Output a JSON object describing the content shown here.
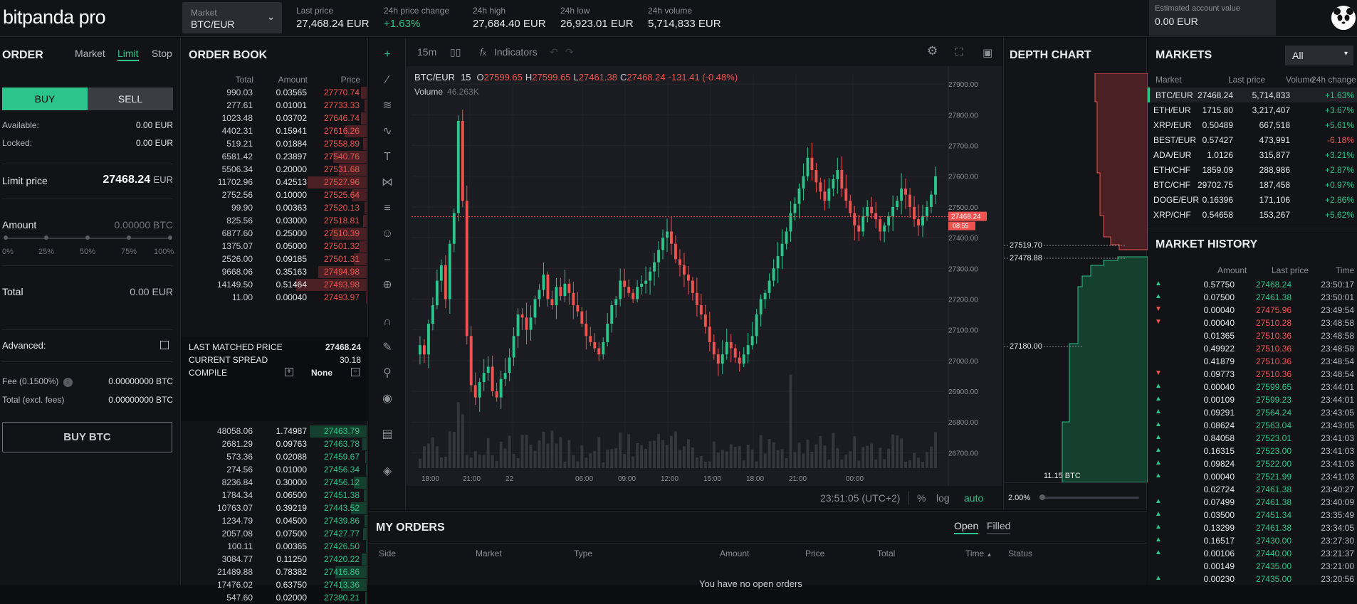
{
  "topbar": {
    "logo": "bitpanda",
    "logo_suffix": "pro",
    "market_label": "Market",
    "market_value": "BTC/EUR",
    "stats": [
      {
        "label": "Last price",
        "value": "27,468.24 EUR",
        "color": "default"
      },
      {
        "label": "24h price change",
        "value": "+1.63%",
        "color": "green"
      },
      {
        "label": "24h high",
        "value": "27,684.40 EUR",
        "color": "default"
      },
      {
        "label": "24h low",
        "value": "26,923.01 EUR",
        "color": "default"
      },
      {
        "label": "24h volume",
        "value": "5,714,833 EUR",
        "color": "default"
      }
    ],
    "account_label": "Estimated account value",
    "account_value": "0.00 EUR"
  },
  "order": {
    "title": "ORDER",
    "tabs": [
      "Market",
      "Limit",
      "Stop"
    ],
    "active_tab": "Limit",
    "buy": "BUY",
    "sell": "SELL",
    "available_label": "Available:",
    "available_value": "0.00 EUR",
    "locked_label": "Locked:",
    "locked_value": "0.00 EUR",
    "limit_label": "Limit price",
    "limit_value": "27468.24",
    "limit_unit": "EUR",
    "amount_label": "Amount",
    "amount_value": "0.00000",
    "amount_unit": "BTC",
    "slider_ticks": [
      "0%",
      "25%",
      "50%",
      "75%",
      "100%"
    ],
    "total_label": "Total",
    "total_value": "0.00",
    "total_unit": "EUR",
    "advanced_label": "Advanced:",
    "fee_label": "Fee (0.1500%)",
    "fee_value": "0.00000000 BTC",
    "total_excl_label": "Total (excl. fees)",
    "total_excl_value": "0.00000000 BTC",
    "buy_button": "BUY BTC"
  },
  "orderbook": {
    "title": "ORDER BOOK",
    "headers": [
      "Total",
      "Amount",
      "Price"
    ],
    "asks": [
      {
        "total": "990.03",
        "amount": "0.03565",
        "price": "27770.74",
        "depth": 0.03
      },
      {
        "total": "277.61",
        "amount": "0.01001",
        "price": "27733.33",
        "depth": 0.01
      },
      {
        "total": "1023.48",
        "amount": "0.03702",
        "price": "27646.74",
        "depth": 0.03
      },
      {
        "total": "4402.31",
        "amount": "0.15941",
        "price": "27616.26",
        "depth": 0.12
      },
      {
        "total": "519.21",
        "amount": "0.01884",
        "price": "27558.89",
        "depth": 0.02
      },
      {
        "total": "6581.42",
        "amount": "0.23897",
        "price": "27540.76",
        "depth": 0.18
      },
      {
        "total": "5506.34",
        "amount": "0.20000",
        "price": "27531.68",
        "depth": 0.15
      },
      {
        "total": "11702.96",
        "amount": "0.42513",
        "price": "27527.96",
        "depth": 0.32
      },
      {
        "total": "2752.56",
        "amount": "0.10000",
        "price": "27525.64",
        "depth": 0.08
      },
      {
        "total": "99.90",
        "amount": "0.00363",
        "price": "27520.13",
        "depth": 0.01
      },
      {
        "total": "825.56",
        "amount": "0.03000",
        "price": "27518.81",
        "depth": 0.02
      },
      {
        "total": "6877.60",
        "amount": "0.25000",
        "price": "27510.39",
        "depth": 0.19
      },
      {
        "total": "1375.07",
        "amount": "0.05000",
        "price": "27501.32",
        "depth": 0.04
      },
      {
        "total": "2526.00",
        "amount": "0.09185",
        "price": "27501.31",
        "depth": 0.07
      },
      {
        "total": "9668.06",
        "amount": "0.35163",
        "price": "27494.98",
        "depth": 0.26
      },
      {
        "total": "14149.50",
        "amount": "0.51464",
        "price": "27493.98",
        "depth": 0.38
      },
      {
        "total": "11.00",
        "amount": "0.00040",
        "price": "27493.97",
        "depth": 0.005
      }
    ],
    "last_matched_label": "LAST MATCHED PRICE",
    "last_matched_value": "27468.24",
    "spread_label": "CURRENT SPREAD",
    "spread_value": "30.18",
    "compile_label": "COMPILE",
    "compile_value": "None",
    "bids": [
      {
        "total": "48058.06",
        "amount": "1.74987",
        "price": "27463.79",
        "depth": 1.0
      },
      {
        "total": "2681.29",
        "amount": "0.09763",
        "price": "27463.78",
        "depth": 0.07
      },
      {
        "total": "573.36",
        "amount": "0.02088",
        "price": "27459.67",
        "depth": 0.02
      },
      {
        "total": "274.56",
        "amount": "0.01000",
        "price": "27456.34",
        "depth": 0.01
      },
      {
        "total": "8236.84",
        "amount": "0.30000",
        "price": "27456.12",
        "depth": 0.22
      },
      {
        "total": "1784.34",
        "amount": "0.06500",
        "price": "27451.38",
        "depth": 0.05
      },
      {
        "total": "10763.07",
        "amount": "0.39219",
        "price": "27443.52",
        "depth": 0.28
      },
      {
        "total": "1234.79",
        "amount": "0.04500",
        "price": "27439.86",
        "depth": 0.04
      },
      {
        "total": "2057.08",
        "amount": "0.07500",
        "price": "27427.77",
        "depth": 0.06
      },
      {
        "total": "100.11",
        "amount": "0.00365",
        "price": "27426.50",
        "depth": 0.01
      },
      {
        "total": "3084.77",
        "amount": "0.11250",
        "price": "27420.22",
        "depth": 0.09
      },
      {
        "total": "21489.88",
        "amount": "0.78382",
        "price": "27416.86",
        "depth": 0.55
      },
      {
        "total": "17476.02",
        "amount": "0.63750",
        "price": "27413.36",
        "depth": 0.45
      },
      {
        "total": "547.60",
        "amount": "0.02000",
        "price": "27380.21",
        "depth": 0.02
      }
    ]
  },
  "chart": {
    "interval": "15m",
    "indicators_label": "Indicators",
    "symbol": "BTC/EUR",
    "symbol_interval": "15",
    "ohlc": {
      "o": "27599.65",
      "h": "27599.65",
      "l": "27461.38",
      "c": "27468.24",
      "change": "-131.41 (-0.48%)"
    },
    "volume_label": "Volume",
    "volume_value": "46.263K",
    "last_price_tag": "27468.24",
    "countdown_tag": "08:55",
    "time_display": "23:51:05 (UTC+2)",
    "bottom_opts": [
      "%",
      "log",
      "auto"
    ],
    "up_color": "#2bc48a",
    "down_color": "#ef5350"
  },
  "chart_data": {
    "type": "candlestick",
    "x_ticks": [
      "18:00",
      "21:00",
      "22",
      "06:00",
      "09:00",
      "12:00",
      "15:00",
      "18:00",
      "21:00",
      "00:00"
    ],
    "y_ticks": [
      "27900.00",
      "27800.00",
      "27700.00",
      "27600.00",
      "27500.00",
      "27400.00",
      "27300.00",
      "27200.00",
      "27100.00",
      "27000.00",
      "26900.00",
      "26800.00",
      "26700.00"
    ],
    "ylim": [
      26650,
      27935
    ],
    "series": [
      {
        "name": "Volume",
        "values": []
      }
    ],
    "closes": [
      27050,
      27020,
      27120,
      27180,
      27260,
      27310,
      27200,
      27380,
      27480,
      27780,
      27520,
      27080,
      26920,
      26880,
      26930,
      26960,
      26980,
      26900,
      26880,
      26940,
      26960,
      27010,
      27080,
      27150,
      27140,
      27100,
      27140,
      27200,
      27230,
      27280,
      27200,
      27180,
      27240,
      27210,
      27250,
      27220,
      27180,
      27160,
      27120,
      27080,
      27060,
      27040,
      27020,
      27060,
      27120,
      27180,
      27200,
      27260,
      27240,
      27220,
      27200,
      27240,
      27250,
      27260,
      27290,
      27320,
      27360,
      27400,
      27420,
      27380,
      27330,
      27310,
      27280,
      27260,
      27220,
      27180,
      27150,
      27110,
      27060,
      27020,
      26990,
      27020,
      27060,
      27040,
      27010,
      26990,
      27020,
      27050,
      27080,
      27150,
      27200,
      27220,
      27260,
      27300,
      27340,
      27380,
      27420,
      27480,
      27510,
      27560,
      27600,
      27660,
      27620,
      27580,
      27550,
      27520,
      27560,
      27590,
      27620,
      27560,
      27520,
      27480,
      27440,
      27420,
      27470,
      27500,
      27480,
      27460,
      27420,
      27440,
      27470,
      27500,
      27520,
      27560,
      27540,
      27500,
      27460,
      27440,
      27470,
      27500,
      27540,
      27600
    ]
  },
  "depth": {
    "title": "DEPTH CHART",
    "ask_label": "27519.70",
    "mid_label": "27478.88",
    "bid_label": "27180.00",
    "volume_label": "11.15 BTC",
    "zoom_label": "2.00%"
  },
  "my_orders": {
    "title": "MY ORDERS",
    "tabs": [
      "Open",
      "Filled"
    ],
    "active_tab": "Open",
    "columns": [
      "Side",
      "Market",
      "Type",
      "Amount",
      "Price",
      "Total",
      "Time",
      "Status"
    ],
    "empty": "You have no open orders"
  },
  "markets": {
    "title": "MARKETS",
    "filter_value": "All",
    "headers": [
      "Market",
      "Last price",
      "Volume",
      "24h change"
    ],
    "rows": [
      {
        "market": "BTC/EUR",
        "price": "27468.24",
        "volume": "5,714,833",
        "change": "+1.63%",
        "dir": "up"
      },
      {
        "market": "ETH/EUR",
        "price": "1715.80",
        "volume": "3,217,407",
        "change": "+3.67%",
        "dir": "up"
      },
      {
        "market": "XRP/EUR",
        "price": "0.50489",
        "volume": "667,518",
        "change": "+5.61%",
        "dir": "up"
      },
      {
        "market": "BEST/EUR",
        "price": "0.57427",
        "volume": "473,991",
        "change": "-6.18%",
        "dir": "down"
      },
      {
        "market": "ADA/EUR",
        "price": "1.0126",
        "volume": "315,877",
        "change": "+3.21%",
        "dir": "up"
      },
      {
        "market": "ETH/CHF",
        "price": "1859.09",
        "volume": "288,986",
        "change": "+2.87%",
        "dir": "up"
      },
      {
        "market": "BTC/CHF",
        "price": "29702.75",
        "volume": "187,458",
        "change": "+0.97%",
        "dir": "up"
      },
      {
        "market": "DOGE/EUR",
        "price": "0.16396",
        "volume": "171,106",
        "change": "+2.86%",
        "dir": "up"
      },
      {
        "market": "XRP/CHF",
        "price": "0.54658",
        "volume": "153,267",
        "change": "+5.62%",
        "dir": "up"
      }
    ]
  },
  "history": {
    "title": "MARKET HISTORY",
    "headers": [
      "Amount",
      "Last price",
      "Time"
    ],
    "rows": [
      {
        "dir": "up",
        "amount": "0.57750",
        "price": "27468.24",
        "time": "23:50:17"
      },
      {
        "dir": "up",
        "amount": "0.07500",
        "price": "27461.38",
        "time": "23:50:01"
      },
      {
        "dir": "down",
        "amount": "0.00040",
        "price": "27475.96",
        "time": "23:49:54"
      },
      {
        "dir": "down",
        "amount": "0.00040",
        "price": "27510.28",
        "time": "23:48:58"
      },
      {
        "dir": "none-red",
        "amount": "0.01365",
        "price": "27510.36",
        "time": "23:48:58"
      },
      {
        "dir": "none-red",
        "amount": "0.49922",
        "price": "27510.36",
        "time": "23:48:58"
      },
      {
        "dir": "none-red",
        "amount": "0.41879",
        "price": "27510.36",
        "time": "23:48:54"
      },
      {
        "dir": "down",
        "amount": "0.09773",
        "price": "27510.36",
        "time": "23:48:54"
      },
      {
        "dir": "up",
        "amount": "0.00040",
        "price": "27599.65",
        "time": "23:44:01"
      },
      {
        "dir": "up",
        "amount": "0.00109",
        "price": "27599.23",
        "time": "23:44:01"
      },
      {
        "dir": "up",
        "amount": "0.09291",
        "price": "27564.24",
        "time": "23:43:05"
      },
      {
        "dir": "up",
        "amount": "0.08624",
        "price": "27563.04",
        "time": "23:43:05"
      },
      {
        "dir": "up",
        "amount": "0.84058",
        "price": "27523.01",
        "time": "23:41:03"
      },
      {
        "dir": "up",
        "amount": "0.16315",
        "price": "27523.00",
        "time": "23:41:03"
      },
      {
        "dir": "up",
        "amount": "0.09824",
        "price": "27522.00",
        "time": "23:41:03"
      },
      {
        "dir": "up",
        "amount": "0.00040",
        "price": "27521.99",
        "time": "23:41:03"
      },
      {
        "dir": "none-green",
        "amount": "0.02724",
        "price": "27461.38",
        "time": "23:40:27"
      },
      {
        "dir": "up",
        "amount": "0.07499",
        "price": "27461.38",
        "time": "23:40:09"
      },
      {
        "dir": "up",
        "amount": "0.03500",
        "price": "27451.34",
        "time": "23:35:49"
      },
      {
        "dir": "up",
        "amount": "0.13299",
        "price": "27461.38",
        "time": "23:34:05"
      },
      {
        "dir": "up",
        "amount": "0.16517",
        "price": "27430.00",
        "time": "23:27:30"
      },
      {
        "dir": "up",
        "amount": "0.00106",
        "price": "27440.00",
        "time": "23:21:37"
      },
      {
        "dir": "none-green",
        "amount": "0.00149",
        "price": "27435.00",
        "time": "23:21:00"
      },
      {
        "dir": "up",
        "amount": "0.00230",
        "price": "27435.00",
        "time": "23:20:56"
      }
    ]
  }
}
